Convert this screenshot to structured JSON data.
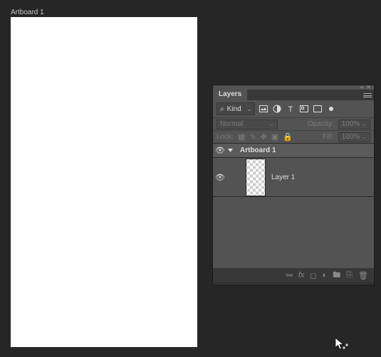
{
  "artboard": {
    "label": "Artboard 1"
  },
  "panel": {
    "title": "Layers",
    "filter": {
      "label": "Kind"
    },
    "blend": {
      "mode": "Normal",
      "opacity_label": "Opacity:",
      "opacity_value": "100%"
    },
    "lock": {
      "label": "Lock:",
      "fill_label": "Fill:",
      "fill_value": "100%"
    },
    "layers": [
      {
        "name": "Artboard 1"
      },
      {
        "name": "Layer 1"
      }
    ]
  }
}
